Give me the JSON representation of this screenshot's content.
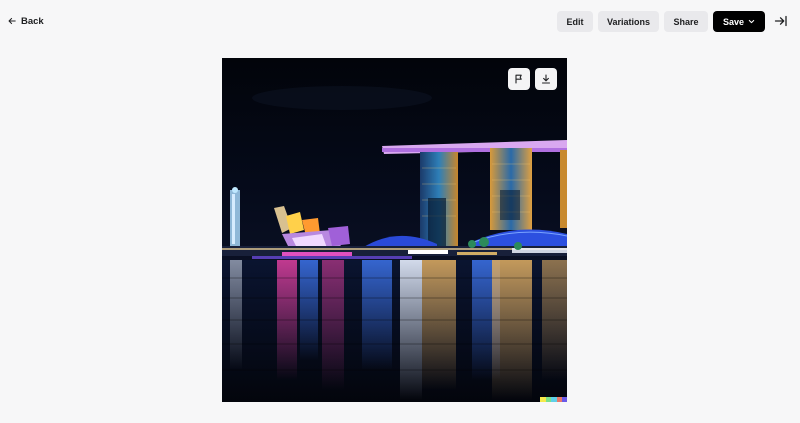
{
  "header": {
    "back_label": "Back",
    "edit_label": "Edit",
    "variations_label": "Variations",
    "share_label": "Share",
    "save_label": "Save"
  },
  "icons": {
    "back": "arrow-left-icon",
    "save_menu": "chevron-down-icon",
    "collapse": "collapse-panel-icon",
    "report": "flag-icon",
    "download": "download-icon"
  },
  "colors": {
    "page_background": "#f7f7f8",
    "button_background": "#e9e9ec",
    "primary_button": "#000000",
    "signature": [
      "#f5e94a",
      "#7be08a",
      "#5fd0e8",
      "#e8796a",
      "#6a5ae8"
    ]
  },
  "image": {
    "subject": "night city skyline over water"
  }
}
